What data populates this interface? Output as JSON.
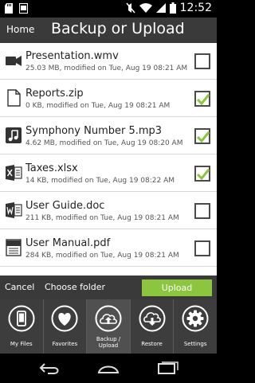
{
  "status": {
    "time": "12:52"
  },
  "appbar": {
    "home_label": "Home",
    "title": "Backup or Upload"
  },
  "files": [
    {
      "name": "Presentation.wmv",
      "meta": "25.03 MB, modified on Tue, Aug 19 08:21 AM",
      "icon": "video-file-icon",
      "checked": false
    },
    {
      "name": "Reports.zip",
      "meta": "0 KB, modified on Tue, Aug 19 08:21 AM",
      "icon": "document-file-icon",
      "checked": true
    },
    {
      "name": "Symphony Number 5.mp3",
      "meta": "4.62 MB, modified on Tue, Aug 19 08:20 AM",
      "icon": "music-file-icon",
      "checked": true
    },
    {
      "name": "Taxes.xlsx",
      "meta": "14 KB, modified on Tue, Aug 19 08:22 AM",
      "icon": "excel-file-icon",
      "checked": true
    },
    {
      "name": "User Guide.doc",
      "meta": "211 KB, modified on Tue, Aug 19 08:21 AM",
      "icon": "word-file-icon",
      "checked": false
    },
    {
      "name": "User Manual.pdf",
      "meta": "284 KB, modified on Tue, Aug 19 08:21 AM",
      "icon": "pdf-file-icon",
      "checked": false
    }
  ],
  "actions": {
    "cancel_label": "Cancel",
    "choose_label": "Choose folder",
    "upload_label": "Upload"
  },
  "tabs": [
    {
      "label": "My Files",
      "icon": "phone-icon",
      "active": false
    },
    {
      "label": "Favorites",
      "icon": "heart-icon",
      "active": false
    },
    {
      "label": "Backup / Upload",
      "icon": "cloud-upload-icon",
      "active": true
    },
    {
      "label": "Restore",
      "icon": "cloud-download-icon",
      "active": false
    },
    {
      "label": "Settings",
      "icon": "gear-icon",
      "active": false
    }
  ],
  "colors": {
    "accent": "#8cc63f",
    "bar": "#3a3a3a"
  }
}
